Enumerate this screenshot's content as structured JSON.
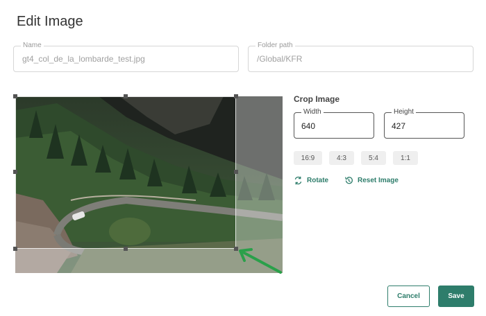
{
  "dialog": {
    "title": "Edit Image"
  },
  "name_field": {
    "label": "Name",
    "value": "gt4_col_de_la_lombarde_test.jpg"
  },
  "folder_field": {
    "label": "Folder path",
    "value": "/Global/KFR"
  },
  "crop": {
    "section_label": "Crop Image",
    "width": {
      "label": "Width",
      "value": "640"
    },
    "height": {
      "label": "Height",
      "value": "427"
    },
    "ratios": [
      "16:9",
      "4:3",
      "5:4",
      "1:1"
    ],
    "rotate_label": "Rotate",
    "reset_label": "Reset Image"
  },
  "footer": {
    "cancel_label": "Cancel",
    "save_label": "Save"
  },
  "colors": {
    "accent": "#2e7d6b",
    "annotation_arrow": "#2aa04a"
  }
}
